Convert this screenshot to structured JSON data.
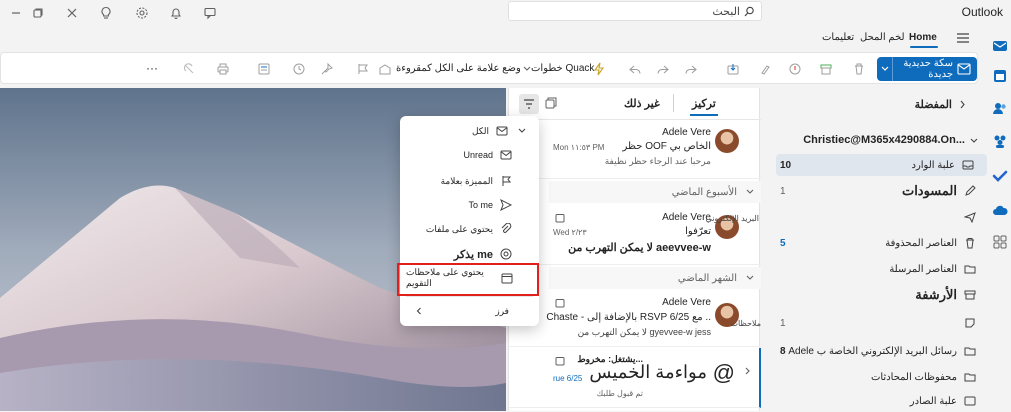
{
  "window": {
    "app_title": "Outlook",
    "search_placeholder": "البحث"
  },
  "tabs": [
    {
      "label": "Home",
      "active": true
    },
    {
      "label": "لخم المحل"
    },
    {
      "label": "تعليمات"
    }
  ],
  "ribbon": {
    "new_mail": "سكة حديدية جديدة",
    "quick_steps": "خطوات Quack",
    "mark_all": "وضع علامة على الكل كمقروءة",
    "more": "···"
  },
  "folders": {
    "favorites": "المفضلة",
    "account": "Christiec@M365x4290884.On...",
    "items": [
      {
        "label": "علبة الوارد",
        "count": "10",
        "selected": true
      },
      {
        "label": "المسودات",
        "count": "1",
        "large": true
      },
      {
        "label": "",
        "count": ""
      },
      {
        "label": "العناصر المحذوفة",
        "count": "5"
      },
      {
        "label": "العناصر المرسلة",
        "count": ""
      },
      {
        "label": "الأرشفة",
        "count": "",
        "large": true
      },
      {
        "label": "",
        "count": "1"
      },
      {
        "label": "رسائل البريد الإلكتروني الخاصة ب Adele",
        "count": "8"
      },
      {
        "label": "محفوظات المحادثات",
        "count": ""
      },
      {
        "label": "علبة الصادر",
        "count": ""
      }
    ]
  },
  "message_list": {
    "tab_focused": "تركيز",
    "tab_other": "غير ذلك",
    "sections": {
      "last_week": "الأسبوع الماضي",
      "last_month": "الشهر الماضي"
    },
    "messages": [
      {
        "sender": "Adele Vere",
        "subject": "حظر OOF الخاص بي",
        "time": "Mon ١١:٥٣ PM",
        "preview": "مرحبا عند الرجاء حظر نظيفة"
      },
      {
        "sender": "Adele Vere",
        "prefix": "البريد الإلكتروني",
        "subject": "تعرّفوا",
        "time": "Wed ٢/٢٣",
        "preview": "لا يمكن التهرب من aeevvee-w"
      },
      {
        "sender": "Adele Vere",
        "prefix": "ملاحظات",
        "subject": "Chaste - بالإضافة إلى RSVP مع 6/25 ..",
        "time": "",
        "preview": "لا يمكن التهرب من gyevvee-w jess"
      },
      {
        "sender": "مواءمة الخميس",
        "prefix": "يشتغل: مخروط...",
        "subject": "@",
        "time": "rue 6/25",
        "preview": "تم قبول طلبك"
      }
    ]
  },
  "filter_menu": {
    "items": [
      {
        "label": "الكل",
        "icon": "mail-icon",
        "top_item": true
      },
      {
        "label": "Unread",
        "icon": "envelope-icon"
      },
      {
        "label": "المميزة بعلامة",
        "icon": "flag-icon"
      },
      {
        "label": "To me",
        "icon": "send-icon"
      },
      {
        "label": "يحتوي على ملفات",
        "icon": "paperclip-icon"
      },
      {
        "label": "يذكر me",
        "icon": "mention-icon"
      },
      {
        "label": "يحتوي على ملاحظات التقويم",
        "icon": "calendar-icon",
        "highlighted": true
      },
      {
        "label": "فرز",
        "icon": "chevron-left-icon",
        "sort": true
      }
    ]
  },
  "colors": {
    "accent": "#0f6cbd",
    "highlight_border": "#e0201c"
  }
}
